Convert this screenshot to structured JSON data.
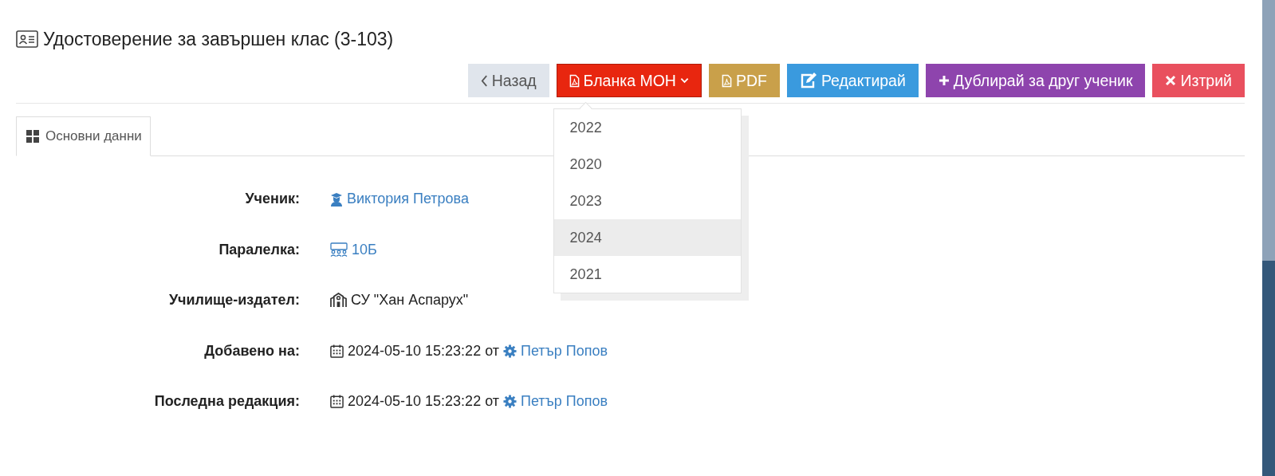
{
  "title": "Удостоверение за завършен клас (3-103)",
  "buttons": [
    {
      "kind": "back",
      "label": "Назад",
      "color": "#e0e5ec"
    },
    {
      "kind": "dropdown",
      "label": "Бланка МОН",
      "color": "#e8260f",
      "expanded": true
    },
    {
      "kind": "pdf",
      "label": "PDF",
      "color": "#c9a04a"
    },
    {
      "kind": "edit",
      "label": "Редактирай",
      "color": "#3a9ade"
    },
    {
      "kind": "duplicate",
      "label": "Дублирай за друг ученик",
      "color": "#8e44ad"
    },
    {
      "kind": "delete",
      "label": "Изтрий",
      "color": "#e9505e"
    }
  ],
  "dropdown_items": [
    {
      "label": "2022",
      "selected": false
    },
    {
      "label": "2020",
      "selected": false
    },
    {
      "label": "2023",
      "selected": false
    },
    {
      "label": "2024",
      "selected": true
    },
    {
      "label": "2021",
      "selected": false
    }
  ],
  "tabs": [
    {
      "label": "Основни данни",
      "selected": true
    }
  ],
  "rows": [
    {
      "kind": "student",
      "label": "Ученик:",
      "value": "Виктория Петрова"
    },
    {
      "kind": "class",
      "label": "Паралелка:",
      "value": "10Б"
    },
    {
      "kind": "school",
      "label": "Училище-издател:",
      "value": "СУ \"Хан Аспарух\""
    },
    {
      "kind": "timestamp",
      "label": "Добавено на:",
      "value": "2024-05-10 15:23:22",
      "by": "от",
      "user": "Петър Попов"
    },
    {
      "kind": "timestamp",
      "label": "Последна редакция:",
      "value": "2024-05-10 15:23:22",
      "by": "от",
      "user": "Петър Попов"
    }
  ]
}
